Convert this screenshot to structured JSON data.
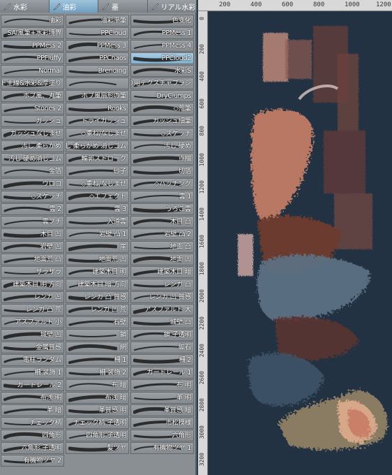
{
  "tabs": [
    {
      "label": "水彩",
      "active": false
    },
    {
      "label": "油彩",
      "active": true
    },
    {
      "label": "墨",
      "active": false
    },
    {
      "label": "リアル水彩",
      "active": false
    }
  ],
  "brushes": [
    [
      "油彩",
      "油彩平筆",
      "色变化"
    ],
    [
      "SAI風筆+水彩境界",
      "PPCloud",
      "PPMess 1"
    ],
    [
      "PPMess 2",
      "PPMess 3",
      "PPMess 4"
    ],
    [
      "PPFluffy",
      "PPChaos",
      "PPCloud2"
    ],
    [
      "Normal",
      "Brending",
      "水彩S"
    ],
    [
      "フラット主線&水彩&厚塗り",
      "",
      "厚塗り用テクスチャブラシ"
    ],
    [
      "ボブ風、丸筆",
      "ボブ風扇形の筆",
      "DryClumps"
    ],
    [
      "Stones 2",
      "Rooks",
      "◇荒筆"
    ],
    [
      "ガッシュ",
      "ドライガッシュ",
      "ガッシュ細筆"
    ],
    [
      "ガッシュなじませ",
      "◇重ね/なじませ",
      "◇スケッチ"
    ],
    [
      "汚し 柔らかめ",
      "汚し 柔らかめ 消しゴム",
      "汚し 硬め"
    ],
    [
      "汚し 硬め消しゴム",
      "輪郭ストローク",
      "点描"
    ],
    [
      "金箔",
      "砂子",
      "切箔"
    ],
    [
      "ウロコ",
      "◇重ね/なじませ",
      "◇ハッチング"
    ],
    [
      "◇スケッチ",
      "◇エフェクト",
      "雲 1"
    ],
    [
      "雲 2",
      "雲 3",
      "うろこ雲"
    ],
    [
      "雲フチ",
      "入道雲",
      "木目 凸"
    ],
    [
      "木目 凹",
      "岩壁 凸 1",
      "岩壁 凸 2"
    ],
    [
      "岩壁 凹",
      "崖",
      "地面 凸"
    ],
    [
      "地面荒 凸",
      "地面荒 凹",
      "地面 凹"
    ],
    [
      "ザラザラ",
      "建築木目 明",
      "建築木目 暗"
    ],
    [
      "建築木目 明 方向",
      "建築木目 暗 方向",
      "レンガ 凸"
    ],
    [
      "レンガ 凹",
      "レンガ 凸 質感",
      "レンガ 凹 質感"
    ],
    [
      "レンガ 凸 荒",
      "レンガ 凹 荒",
      "アスファルト 大"
    ],
    [
      "アスファルト 小",
      "石壁",
      "城壁 凸"
    ],
    [
      "城壁 凹",
      "鎖",
      "鎖 子透明"
    ],
    [
      "金属質感",
      "網",
      "鉱石"
    ],
    [
      "電柱ランダム",
      "柵 1",
      "柵 2"
    ],
    [
      "柵 装飾 1",
      "柵 装飾 2",
      "ガードレール 1"
    ],
    [
      "ガードレール 2",
      "布 暗",
      "布 明"
    ],
    [
      "布浅 明",
      "布浅 暗",
      "革 明"
    ],
    [
      "革 暗",
      "革質感 明",
      "革質感 暗"
    ],
    [
      "チェック柄",
      "チェック柄 子透明",
      "市松模様"
    ],
    [
      "四角形",
      "四角形 子透明",
      "六角形"
    ],
    [
      "六角形 子透明",
      "髪ツヤ",
      "有機物ツヤ 1"
    ],
    [
      "有機物ツヤ 2"
    ]
  ],
  "selected_brush": "PPCloud2",
  "ruler_top": [
    "200",
    "400",
    "600",
    "800",
    "1000",
    "1200"
  ],
  "ruler_left": [
    "0",
    "200",
    "400",
    "600",
    "800",
    "1000",
    "1200",
    "1400",
    "1600",
    "1800",
    "2000",
    "2200",
    "2400",
    "2600",
    "2800",
    "3000",
    "3200"
  ],
  "colors": {
    "panel": "#8a8f94",
    "tab_active": "#7fb1cf",
    "canvas_bg": "#223242"
  }
}
